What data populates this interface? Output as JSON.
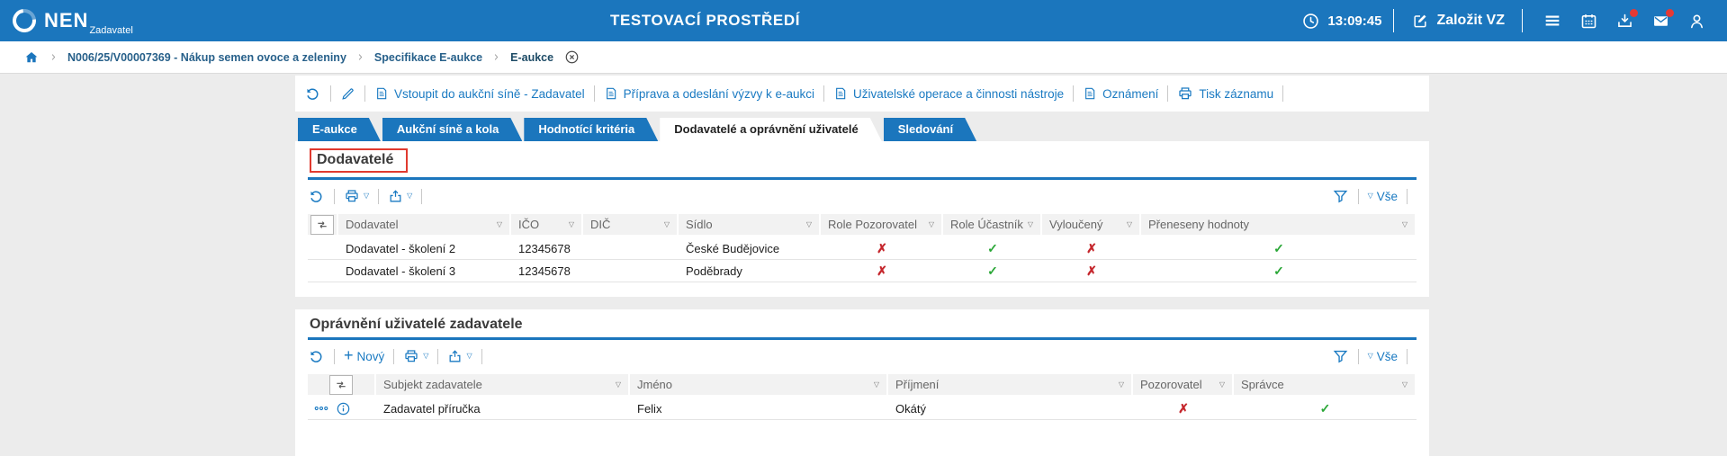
{
  "topbar": {
    "brand": "NEN",
    "brand_sub": "Zadavatel",
    "environment": "TESTOVACÍ PROSTŘEDÍ",
    "time": "13:09:45",
    "create_vz_label": "Založit VZ"
  },
  "breadcrumb": {
    "items": [
      {
        "label": "N006/25/V00007369 - Nákup semen ovoce a zeleniny",
        "current": false
      },
      {
        "label": "Specifikace E-aukce",
        "current": false
      },
      {
        "label": "E-aukce",
        "current": true
      }
    ]
  },
  "record_toolbar": {
    "links": [
      {
        "label": "Vstoupit do aukční síně - Zadavatel",
        "icon": "doc"
      },
      {
        "label": "Příprava a odeslání výzvy k e-aukci",
        "icon": "doc"
      },
      {
        "label": "Uživatelské operace a činnosti nástroje",
        "icon": "doc"
      },
      {
        "label": "Oznámení",
        "icon": "doc"
      },
      {
        "label": "Tisk záznamu",
        "icon": "printer"
      }
    ]
  },
  "tabs": {
    "items": [
      "E-aukce",
      "Aukční síně a kola",
      "Hodnotící kritéria",
      "Dodavatelé a oprávnění uživatelé",
      "Sledování"
    ],
    "active_index": 3
  },
  "suppliers_section": {
    "title": "Dodavatelé",
    "filter_all_label": "Vše",
    "columns": [
      "Dodavatel",
      "IČO",
      "DIČ",
      "Sídlo",
      "Role Pozorovatel",
      "Role Účastník",
      "Vyloučený",
      "Přeneseny hodnoty"
    ],
    "rows": [
      {
        "cells": [
          "Dodavatel - školení 2",
          "12345678",
          "",
          "České Budějovice"
        ],
        "flags": [
          false,
          true,
          false,
          true
        ]
      },
      {
        "cells": [
          "Dodavatel - školení 3",
          "12345678",
          "",
          "Poděbrady"
        ],
        "flags": [
          false,
          true,
          false,
          true
        ]
      }
    ]
  },
  "users_section": {
    "title": "Oprávnění uživatelé zadavatele",
    "new_label": "Nový",
    "filter_all_label": "Vše",
    "columns": [
      "Subjekt zadavatele",
      "Jméno",
      "Příjmení",
      "Pozorovatel",
      "Správce"
    ],
    "rows": [
      {
        "cells": [
          "Zadavatel příručka",
          "Felix",
          "Okátý"
        ],
        "flags": [
          false,
          true
        ]
      }
    ]
  },
  "colors": {
    "topbar_blue": "#1b76bd",
    "link_blue": "#1a7ac2",
    "cross_red": "#c5262c",
    "check_green": "#2aa737",
    "badge_red": "#e53935",
    "highlight_red": "#e03a2f"
  }
}
